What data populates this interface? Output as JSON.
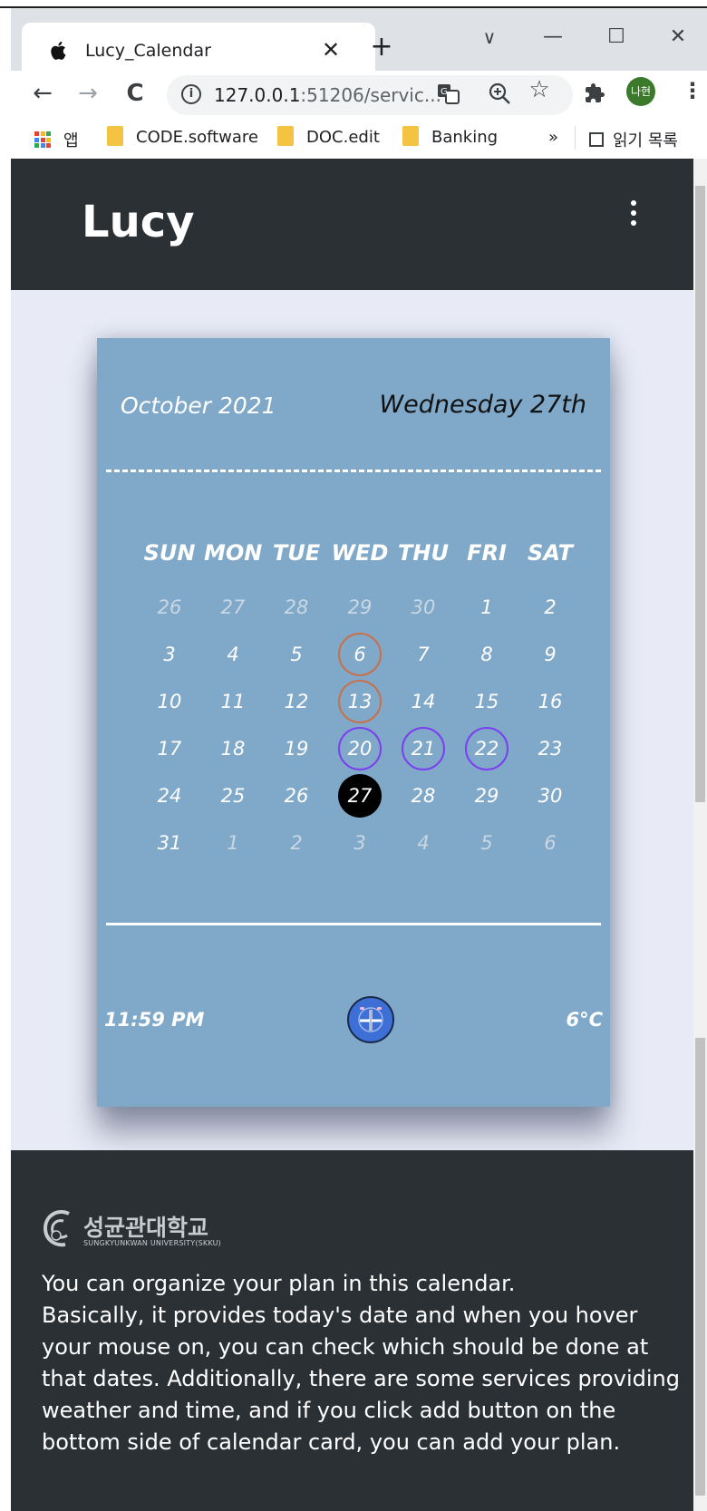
{
  "browser": {
    "tab_title": "Lucy_Calendar",
    "tab_close": "✕",
    "new_tab": "+",
    "url_host": "127.0.0.1",
    "url_rest": ":51206/servic...",
    "back": "←",
    "forward": "→",
    "reload": "C",
    "profile_initials": "나현",
    "bookmarks": {
      "apps_label": "앱",
      "items": [
        "CODE.software",
        "DOC.edit",
        "Banking"
      ],
      "more": "»",
      "reading_list": "읽기 목록"
    },
    "window_controls": {
      "dropdown": "∨",
      "minimize": "—",
      "maximize": "☐",
      "close": "✕"
    }
  },
  "app": {
    "brand": "Lucy"
  },
  "calendar": {
    "month_year": "October 2021",
    "today_label": "Wednesday 27th",
    "weekdays": [
      "SUN",
      "MON",
      "TUE",
      "WED",
      "THU",
      "FRI",
      "SAT"
    ],
    "days": [
      {
        "n": "26",
        "other": true
      },
      {
        "n": "27",
        "other": true
      },
      {
        "n": "28",
        "other": true
      },
      {
        "n": "29",
        "other": true
      },
      {
        "n": "30",
        "other": true
      },
      {
        "n": "1"
      },
      {
        "n": "2"
      },
      {
        "n": "3"
      },
      {
        "n": "4"
      },
      {
        "n": "5"
      },
      {
        "n": "6",
        "ring": "orange"
      },
      {
        "n": "7"
      },
      {
        "n": "8"
      },
      {
        "n": "9"
      },
      {
        "n": "10"
      },
      {
        "n": "11"
      },
      {
        "n": "12"
      },
      {
        "n": "13",
        "ring": "orange"
      },
      {
        "n": "14"
      },
      {
        "n": "15"
      },
      {
        "n": "16"
      },
      {
        "n": "17"
      },
      {
        "n": "18"
      },
      {
        "n": "19"
      },
      {
        "n": "20",
        "ring": "purple"
      },
      {
        "n": "21",
        "ring": "purple"
      },
      {
        "n": "22",
        "ring": "purple"
      },
      {
        "n": "23"
      },
      {
        "n": "24"
      },
      {
        "n": "25"
      },
      {
        "n": "26"
      },
      {
        "n": "27",
        "today": true
      },
      {
        "n": "28"
      },
      {
        "n": "29"
      },
      {
        "n": "30"
      },
      {
        "n": "31"
      },
      {
        "n": "1",
        "other": true
      },
      {
        "n": "2",
        "other": true
      },
      {
        "n": "3",
        "other": true
      },
      {
        "n": "4",
        "other": true
      },
      {
        "n": "5",
        "other": true
      },
      {
        "n": "6",
        "other": true
      }
    ],
    "time": "11:59 PM",
    "temperature": "6°C"
  },
  "colors": {
    "ring_orange": "#c8704a",
    "ring_purple": "#7b3ff0",
    "today_fill": "#000000",
    "card": "#80a9c9",
    "header": "#2b3035",
    "page_bg": "#e8ebf6"
  },
  "footer": {
    "university_name": "성균관대학교",
    "university_en": "SUNGKYUNKWAN UNIVERSITY(SKKU)",
    "description_lines": [
      "You can organize your plan in this calendar.",
      "Basically, it provides today's date and when you hover",
      "your mouse on, you can check which should be done at",
      "that dates. Additionally, there are some services providing",
      "weather and time, and if you click add button on the",
      "bottom side of calendar card, you can add your plan."
    ]
  }
}
